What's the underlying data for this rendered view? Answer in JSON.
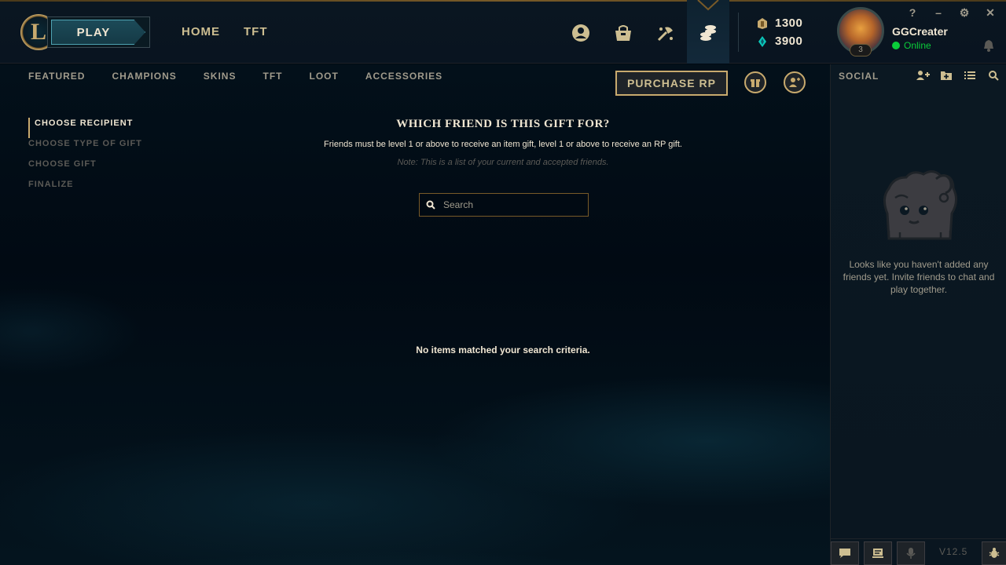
{
  "header": {
    "logo_letter": "L",
    "play_label": "PLAY",
    "nav": [
      "HOME",
      "TFT"
    ],
    "icons": [
      "profile-icon",
      "collection-icon",
      "loot-icon",
      "store-icon"
    ],
    "currency": {
      "rp": "1300",
      "be": "3900",
      "rp_color": "#c8aa6e",
      "be_color": "#0ac8b9"
    },
    "user": {
      "name": "GGCreater",
      "status": "Online",
      "level": "3",
      "status_color": "#0acd3a"
    },
    "window_controls": [
      "?",
      "–",
      "⚙",
      "✕"
    ]
  },
  "subnav": {
    "items": [
      "FEATURED",
      "CHAMPIONS",
      "SKINS",
      "TFT",
      "LOOT",
      "ACCESSORIES"
    ],
    "purchase_label": "PURCHASE RP"
  },
  "steps": [
    {
      "label": "CHOOSE RECIPIENT",
      "active": true
    },
    {
      "label": "CHOOSE TYPE OF GIFT",
      "active": false
    },
    {
      "label": "CHOOSE GIFT",
      "active": false
    },
    {
      "label": "FINALIZE",
      "active": false
    }
  ],
  "gift": {
    "title": "WHICH FRIEND IS THIS GIFT FOR?",
    "subtitle": "Friends must be level 1 or above to receive an item gift, level 1 or above to receive an RP gift.",
    "note": "Note: This is a list of your current and accepted friends.",
    "search_placeholder": "Search",
    "empty_text": "No items matched your search criteria."
  },
  "social": {
    "title": "SOCIAL",
    "empty_message": "Looks like you haven't added any friends yet. Invite friends to chat and play together.",
    "version": "V12.5"
  },
  "colors": {
    "gold": "#c8aa6e",
    "background": "#010a13",
    "text_light": "#f0e6d2"
  }
}
